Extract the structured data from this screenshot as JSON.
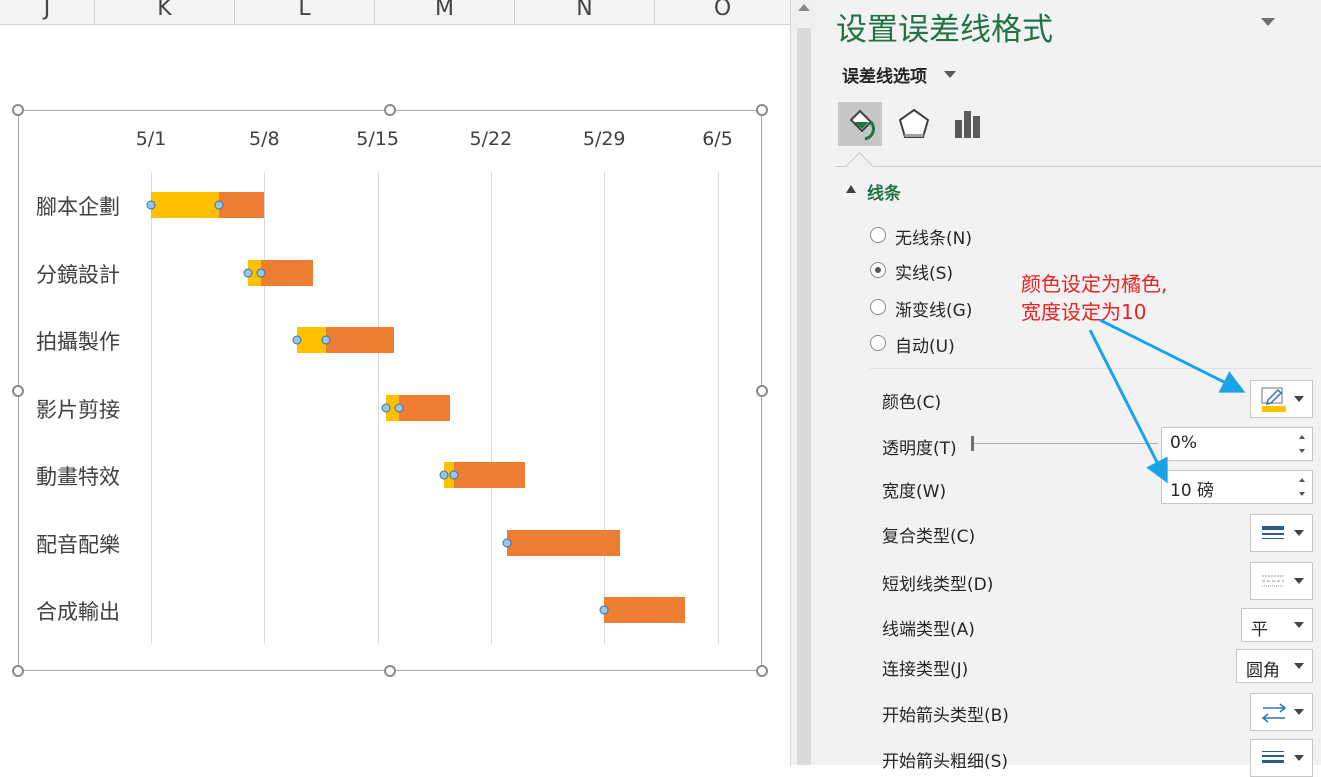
{
  "sheet": {
    "columns": [
      "J",
      "K",
      "L",
      "M",
      "N",
      "O"
    ]
  },
  "chart_data": {
    "type": "bar",
    "title": "",
    "categories": [
      "腳本企劃",
      "分鏡設計",
      "拍攝製作",
      "影片剪接",
      "動畫特效",
      "配音配樂",
      "合成輸出"
    ],
    "x_ticks": [
      "5/1",
      "5/8",
      "5/15",
      "5/22",
      "5/29",
      "6/5"
    ],
    "xlim": [
      "2020-05-01",
      "2020-06-05"
    ],
    "series": [
      {
        "name": "",
        "color": "#ffc000",
        "values": [
          4.2,
          0.8,
          1.8,
          0.8,
          0.6,
          0,
          0
        ]
      },
      {
        "name": "",
        "color": "#ed7d31",
        "values": [
          2.8,
          3.2,
          4.2,
          3.2,
          4.4,
          7.0,
          5.0
        ]
      }
    ],
    "start_offsets_days": [
      0,
      6,
      9,
      14.5,
      18.1,
      22,
      28
    ],
    "grid": true,
    "legend": "none"
  },
  "panel": {
    "title": "设置误差线格式",
    "options_label": "误差线选项",
    "tabs": [
      {
        "name": "fill-line",
        "icon": "paint-bucket-icon",
        "active": true
      },
      {
        "name": "effects",
        "icon": "pentagon-icon",
        "active": false
      },
      {
        "name": "size",
        "icon": "bar-chart-icon",
        "active": false
      }
    ],
    "section_title": "线条",
    "radio_options": [
      {
        "label": "无线条(N)",
        "checked": false
      },
      {
        "label": "实线(S)",
        "checked": true
      },
      {
        "label": "渐变线(G)",
        "checked": false
      },
      {
        "label": "自动(U)",
        "checked": false
      }
    ],
    "props": {
      "color_label": "颜色(C)",
      "transparency_label": "透明度(T)",
      "transparency_value": "0%",
      "width_label": "宽度(W)",
      "width_value": "10 磅",
      "compound_label": "复合类型(C)",
      "dash_label": "短划线类型(D)",
      "cap_label": "线端类型(A)",
      "cap_value": "平",
      "join_label": "连接类型(J)",
      "join_value": "圆角",
      "begin_arrow_label": "开始箭头类型(B)",
      "begin_size_label": "开始箭头粗细(S)"
    },
    "color_swatch": "#ffc000"
  },
  "annotation": {
    "line1": "颜色设定为橘色,",
    "line2": "宽度设定为10",
    "color": "#e52323"
  }
}
